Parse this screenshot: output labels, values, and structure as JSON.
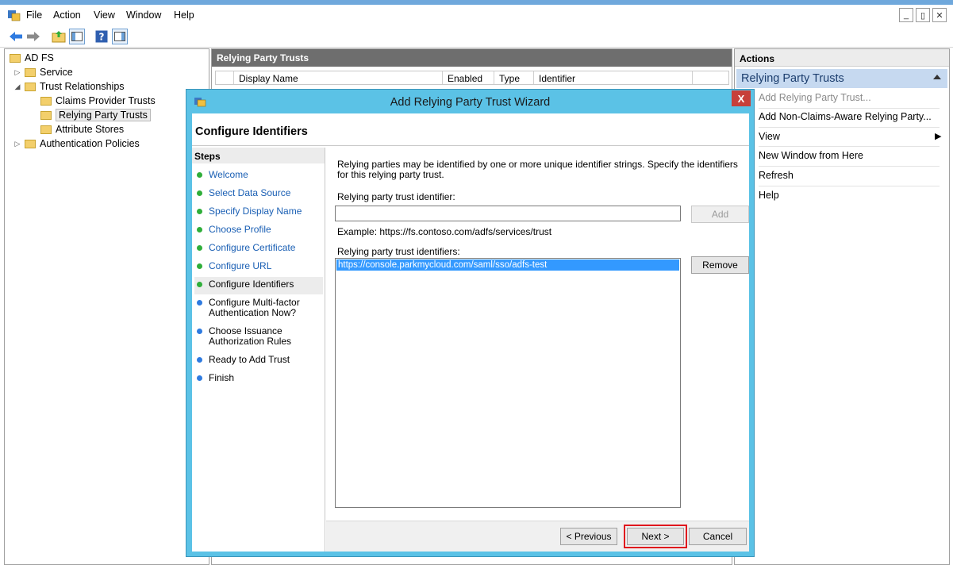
{
  "menubar": {
    "items": [
      "File",
      "Action",
      "View",
      "Window",
      "Help"
    ],
    "mdi_minimize": "_",
    "mdi_restore": "▯",
    "mdi_close": "✕"
  },
  "tree": {
    "root": "AD FS",
    "service": "Service",
    "trust_relationships": "Trust Relationships",
    "claims_provider_trusts": "Claims Provider Trusts",
    "relying_party_trusts": "Relying Party Trusts",
    "attribute_stores": "Attribute Stores",
    "authentication_policies": "Authentication Policies"
  },
  "center": {
    "header": "Relying Party Trusts",
    "columns": [
      "Display Name",
      "Enabled",
      "Type",
      "Identifier"
    ]
  },
  "actions": {
    "header": "Actions",
    "group": "Relying Party Trusts",
    "items": [
      "Add Relying Party Trust...",
      "Add Non-Claims-Aware Relying Party...",
      "View",
      "New Window from Here",
      "Refresh",
      "Help"
    ]
  },
  "wizard": {
    "title": "Add Relying Party Trust Wizard",
    "close": "X",
    "page_title": "Configure Identifiers",
    "steps_header": "Steps",
    "steps": [
      {
        "label": "Welcome",
        "state": "done"
      },
      {
        "label": "Select Data Source",
        "state": "done"
      },
      {
        "label": "Specify Display Name",
        "state": "done"
      },
      {
        "label": "Choose Profile",
        "state": "done"
      },
      {
        "label": "Configure Certificate",
        "state": "done"
      },
      {
        "label": "Configure URL",
        "state": "done"
      },
      {
        "label": "Configure Identifiers",
        "state": "current"
      },
      {
        "label": "Configure Multi-factor Authentication Now?",
        "state": "pending"
      },
      {
        "label": "Choose Issuance Authorization Rules",
        "state": "pending"
      },
      {
        "label": "Ready to Add Trust",
        "state": "pending"
      },
      {
        "label": "Finish",
        "state": "pending"
      }
    ],
    "description": "Relying parties may be identified by one or more unique identifier strings. Specify the identifiers for this relying party trust.",
    "identifier_label": "Relying party trust identifier:",
    "identifier_value": "",
    "add_button": "Add",
    "example": "Example: https://fs.contoso.com/adfs/services/trust",
    "identifiers_label": "Relying party trust identifiers:",
    "identifiers": [
      "https://console.parkmycloud.com/saml/sso/adfs-test"
    ],
    "remove_button": "Remove",
    "previous_button": "< Previous",
    "next_button": "Next >",
    "cancel_button": "Cancel"
  },
  "colors": {
    "dialog_frame": "#5bc2e6",
    "close_button": "#c7403a",
    "done_step_dot": "#2fae3a",
    "pending_step_dot": "#2f7be0",
    "selection": "#3399ff",
    "highlight_box": "#e0161d",
    "actions_group": "#c6d9f0"
  }
}
